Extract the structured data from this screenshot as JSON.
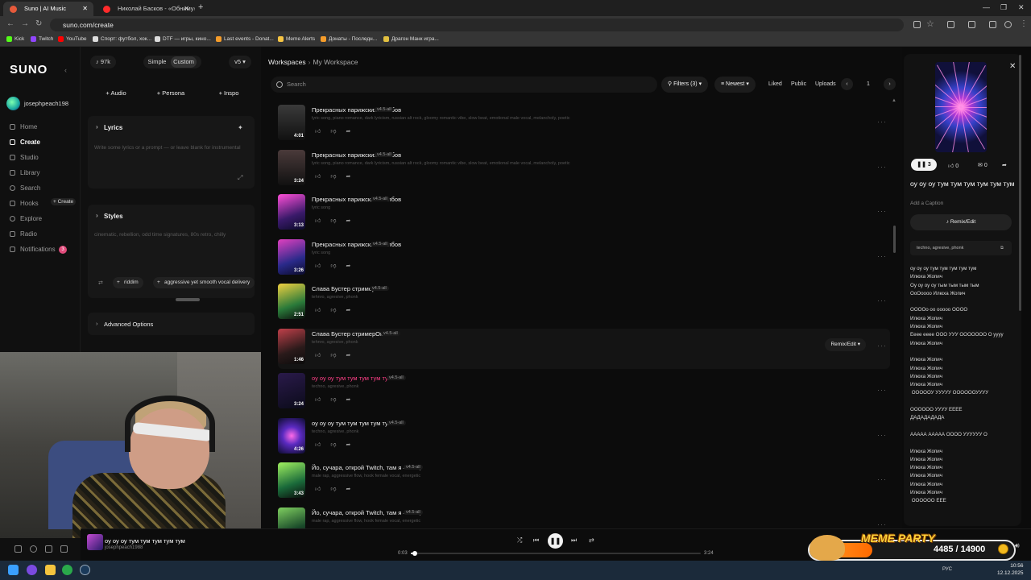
{
  "browser": {
    "tabs": [
      {
        "label": "Suno | AI Music",
        "active": true
      },
      {
        "label": "Николай Басков - «Обниму» (",
        "active": false
      }
    ],
    "url": "suno.com/create",
    "bookmarks": [
      "Kick",
      "Twitch",
      "YouTube",
      "Спорт: футбол, хок...",
      "DTF — игры, кино...",
      "Last events - Donat...",
      "Meme Alerts",
      "Донаты - Последн...",
      "Драгон Манк игра..."
    ]
  },
  "sidebar": {
    "logo": "SUNO",
    "username": "josephpeach198",
    "nav": [
      {
        "label": "Home",
        "icon": "home-icon"
      },
      {
        "label": "Create",
        "icon": "create-icon",
        "active": true
      },
      {
        "label": "Studio",
        "icon": "studio-icon"
      },
      {
        "label": "Library",
        "icon": "library-icon"
      },
      {
        "label": "Search",
        "icon": "search-icon"
      },
      {
        "label": "Hooks",
        "icon": "hooks-icon"
      },
      {
        "label": "Explore",
        "icon": "explore-icon"
      },
      {
        "label": "Radio",
        "icon": "radio-icon"
      },
      {
        "label": "Notifications",
        "icon": "bell-icon"
      }
    ],
    "hooks_badge": "+ Create",
    "notif_count": "3"
  },
  "create": {
    "credits": "97k",
    "mode_simple": "Simple",
    "mode_custom": "Custom",
    "model": "v5",
    "add_audio": "Audio",
    "add_persona": "Persona",
    "add_inspo": "Inspo",
    "lyrics_title": "Lyrics",
    "lyrics_placeholder": "Write some lyrics or a prompt — or leave blank for instrumental",
    "styles_title": "Styles",
    "styles_placeholder": "cinematic, rebellion, odd time signatures, 80s retro, chilly",
    "style_chip_1": "riddim",
    "style_chip_2": "aggressive yet smooth vocal delivery",
    "advanced": "Advanced Options"
  },
  "main": {
    "breadcrumb_root": "Workspaces",
    "breadcrumb_current": "My Workspace",
    "search_placeholder": "Search",
    "filters": "Filters (3)",
    "sort": "Newest",
    "liked": "Liked",
    "public": "Public",
    "uploads": "Uploads",
    "page": "1",
    "songs": [
      {
        "title": "Прекрасных парижских столбов",
        "version": "v4.5-all",
        "tags": "lyric song, piano romance, dark lyricism, russian alt rock, gloomy romantic vibe, slow beat, emotional male vocal, melancholy, poetic",
        "duration": "4:01",
        "pink": false
      },
      {
        "title": "Прекрасных парижских столбов",
        "version": "v4.5-all",
        "tags": "lyric song, piano romance, dark lyricism, russian alt rock, gloomy romantic vibe, slow beat, emotional male vocal, melancholy, poetic",
        "duration": "3:24",
        "pink": false
      },
      {
        "title": "Прекрасных парижских столбов",
        "version": "v4.5-all",
        "tags": "lyric song",
        "duration": "3:13",
        "pink": false
      },
      {
        "title": "Прекрасных парижских столбов",
        "version": "v4.5-all",
        "tags": "lyric song",
        "duration": "3:26",
        "pink": false
      },
      {
        "title": "Слава Бустер стримерОк",
        "version": "v4.5-all",
        "tags": "tehnro, agresive, phonk",
        "duration": "2:51",
        "pink": false
      },
      {
        "title": "Слава Бустер стримерОк",
        "version": "v4.5-all",
        "tags": "tehnro, agresive, phonk",
        "duration": "1:46",
        "pink": false
      },
      {
        "title": "оу оу оу тум тум тум тум тум",
        "version": "v4.5-all",
        "tags": "techno, agresive, phonk",
        "duration": "3:24",
        "pink": true
      },
      {
        "title": "оу оу оу тум тум тум тум тум",
        "version": "v4.5-all",
        "tags": "techno, agresive, phonk",
        "duration": "4:26",
        "pink": false
      },
      {
        "title": "Йо, сучара, открой Twitch, там я — бог,",
        "version": "v4.5-all",
        "tags": "male rap, aggressive flow, hook female vocal, energetic",
        "duration": "3:43",
        "pink": false
      },
      {
        "title": "Йо, сучара, открой Twitch, там я — бог,",
        "version": "v4.5-all",
        "tags": "male rap, aggressive flow, hook female vocal, energetic",
        "duration": "",
        "pink": false
      }
    ],
    "remix_label": "Remix/Edit"
  },
  "detail": {
    "plays": "3",
    "likes": "0",
    "comments": "0",
    "title": "оу оу оу тум тум тум тум тум тум",
    "caption": "Add a Caption",
    "remix": "Remix/Edit",
    "style": "techno, agresive, phonk",
    "lyrics": "оу оу оу тум тум тум тум тум\nИлюха Жопич\nОу оу оу оу тым тым тым тым\nОоОоооо Илюха Жопич\n\nОООOo оо ооооо ОООО\nИлюха Жопич\nИлюха Жопич\nЕеее ееее ООО УУУ ООООООО О уууу\nИлюха Жопич\n\nИлюха Жопич\nИлюха Жопич\nИлюха Жопич\nИлюха Жопич\n ОООООУ УУУУУ ООООООУУУУ\n\nООООOO УУУУ ЕЕЕЕ\nДАДАДАДАДА\n\nААААА ААААА ОООО УУУУУУ О\n\nИлюха Жопич\nИлюха Жопич\nИлюха Жопич\nИлюха Жопич\nИлюха Жопич\nИлюха Жопич\n ОООООO ЕЕЕ"
  },
  "player": {
    "title": "оу оу оу тум тум тум тум тум",
    "artist": "josephpeach1988",
    "current": "0:03",
    "total": "3:24",
    "progress": 0.015
  },
  "overlay": {
    "meme_title": "MEME PARTY",
    "meme_count": "4485 / 14900",
    "meme_progress": 0.3,
    "time": "10:56",
    "date": "12.12.2025",
    "lang": "РУС"
  },
  "colors": {
    "accent_pink": "#ff3f87",
    "meme_gold": "#ffd23a"
  }
}
